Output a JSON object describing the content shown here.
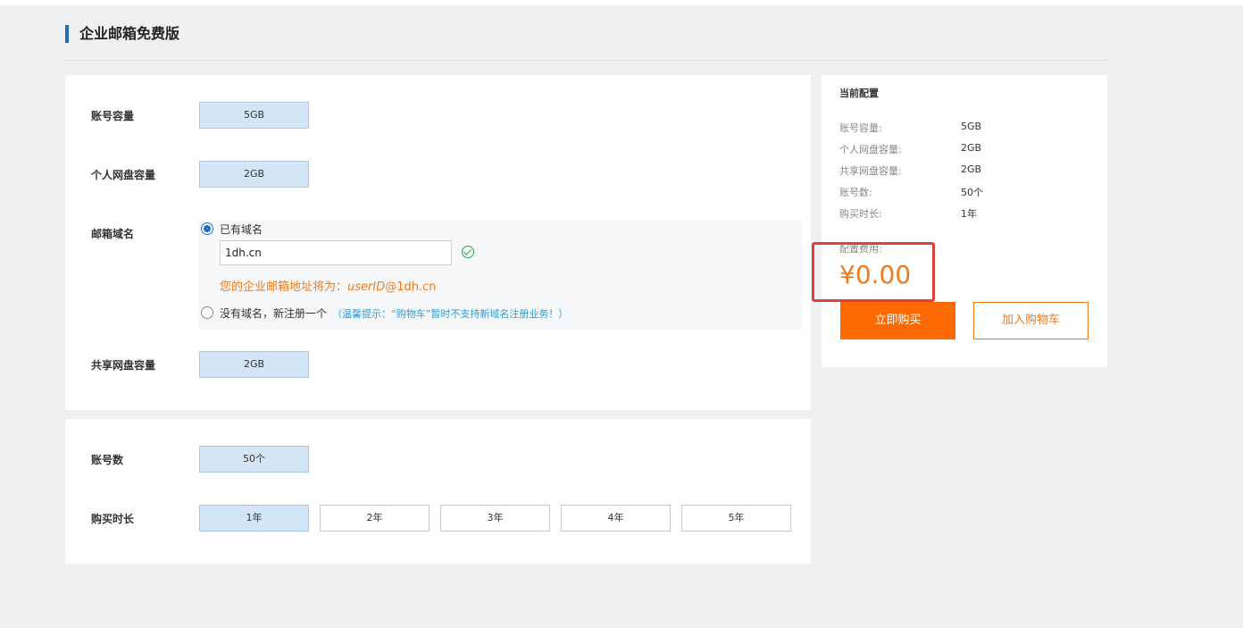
{
  "page": {
    "title": "企业邮箱免费版"
  },
  "form": {
    "capacity": {
      "label": "账号容量",
      "value": "5GB"
    },
    "personal_disk": {
      "label": "个人网盘容量",
      "value": "2GB"
    },
    "domain": {
      "label": "邮箱域名",
      "option_existing": "已有域名",
      "input_value": "1dh.cn",
      "address_prefix": "您的企业邮箱地址将为：",
      "address_user": "userID",
      "address_suffix": "@1dh.cn",
      "option_new": "没有域名，新注册一个",
      "tip": "（温馨提示：“购物车”暂时不支持新域名注册业务！）"
    },
    "shared_disk": {
      "label": "共享网盘容量",
      "value": "2GB"
    },
    "accounts": {
      "label": "账号数",
      "value": "50个"
    },
    "duration": {
      "label": "购买时长",
      "options": [
        "1年",
        "2年",
        "3年",
        "4年",
        "5年"
      ],
      "selected": "1年"
    }
  },
  "summary": {
    "title": "当前配置",
    "rows": [
      {
        "key": "账号容量:",
        "value": "5GB"
      },
      {
        "key": "个人网盘容量:",
        "value": "2GB"
      },
      {
        "key": "共享网盘容量:",
        "value": "2GB"
      },
      {
        "key": "账号数:",
        "value": "50个"
      },
      {
        "key": "购买时长:",
        "value": "1年"
      }
    ],
    "fee_label": "配置费用:",
    "price": "¥0.00",
    "buy_button": "立即购买",
    "cart_button": "加入购物车"
  },
  "colors": {
    "accent": "#1c6cb5",
    "orange": "#f07a1a",
    "buy": "#ff6a00",
    "highlight": "#e0403a",
    "selected": "#d4e5f5"
  }
}
